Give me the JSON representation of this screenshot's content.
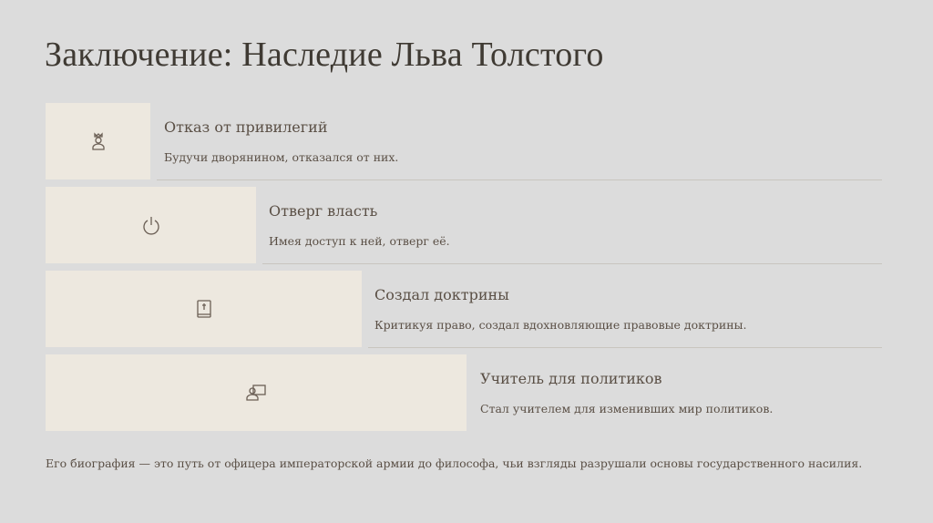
{
  "title": "Заключение: Наследие Льва Толстого",
  "items": [
    {
      "title": "Отказ от привилегий",
      "desc": "Будучи дворянином, отказался от них.",
      "icon": "king-icon"
    },
    {
      "title": "Отверг власть",
      "desc": "Имея доступ к ней, отверг её.",
      "icon": "power-icon"
    },
    {
      "title": "Создал доктрины",
      "desc": "Критикуя право, создал вдохновляющие правовые доктрины.",
      "icon": "bible-icon"
    },
    {
      "title": "Учитель для политиков",
      "desc": "Стал учителем для изменивших мир политиков.",
      "icon": "teacher-icon"
    }
  ],
  "footer": "Его биография — это путь от офицера императорской армии до философа, чьи взгляды разрушали основы государственного насилия."
}
